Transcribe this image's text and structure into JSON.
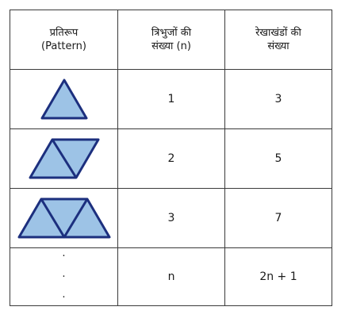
{
  "header": {
    "pattern_line1": "प्रतिरूप",
    "pattern_line2": "(Pattern)",
    "triangles_line1": "त्रिभुजों की",
    "triangles_line2": "संख्या (n)",
    "segments_line1": "रेखाखंडों की",
    "segments_line2": "संख्या"
  },
  "rows": [
    {
      "triangles": "1",
      "segments": "3"
    },
    {
      "triangles": "2",
      "segments": "5"
    },
    {
      "triangles": "3",
      "segments": "7"
    },
    {
      "triangles": "n",
      "segments": "2n + 1"
    }
  ],
  "colors": {
    "fill": "#9dc3e6",
    "stroke": "#1c2f7e",
    "border": "#3a3a3a"
  }
}
